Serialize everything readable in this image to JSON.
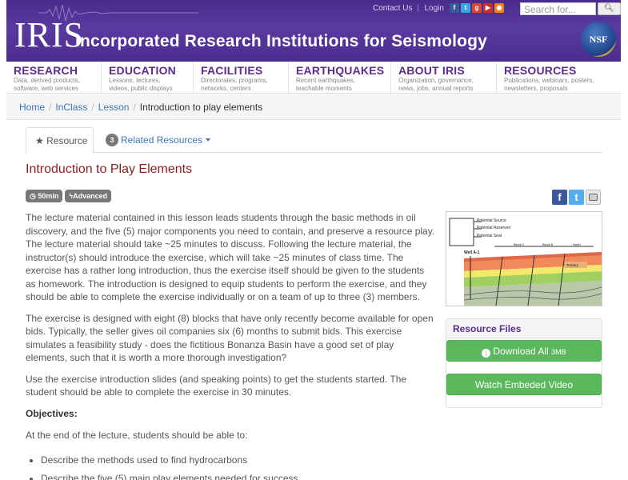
{
  "header": {
    "logo_text": "IRIS",
    "org_title": "Incorporated Research Institutions for Seismology",
    "top_links": [
      "Contact Us",
      "Login"
    ],
    "social_icons": [
      "facebook-icon",
      "twitter-icon",
      "google-plus-icon",
      "youtube-icon",
      "rss-icon"
    ],
    "search_placeholder": "Search for...",
    "nsf_logo_text": "NSF"
  },
  "nav": [
    {
      "title": "RESEARCH",
      "sub1": "Data, derived products,",
      "sub2": "software, web services"
    },
    {
      "title": "EDUCATION",
      "sub1": "Lessons, lectures,",
      "sub2": "videos, public displays"
    },
    {
      "title": "FACILITIES",
      "sub1": "Directorates, programs,",
      "sub2": "networks, centers"
    },
    {
      "title": "EARTHQUAKES",
      "sub1": "Recent earthquakes,",
      "sub2": "teachable moments"
    },
    {
      "title": "ABOUT IRIS",
      "sub1": "Organization, governance,",
      "sub2": "news, jobs, annual reports"
    },
    {
      "title": "RESOURCES",
      "sub1": "Publications, webinars, posters,",
      "sub2": "newsletters, proposals"
    }
  ],
  "breadcrumb": [
    "Home",
    "InClass",
    "Lesson",
    "Introduction to play elements"
  ],
  "tabs": {
    "resource": "Resource",
    "related_count": "3",
    "related": "Related Resources"
  },
  "lesson": {
    "title": "Introduction to Play Elements",
    "duration": "50min",
    "level": "Advanced",
    "paragraphs": [
      "The lecture material contained in this lesson leads students through the basic methods in oil discovery, and the five (5) major components you need to contain, and preserve a resource play. The lecture material should take ~25 minutes to discuss. Following the lecture material, the instructor(s) should introduce the exercise, which will take ~25 minutes of class time. The exercise has a rather long introduction, thus the exercise itself should be given to the students as homework. The introduction is designed to equip students to perform the exercise, and they should be able to complete the exercise individually or on a team of up to three (3) members.",
      "The exercise is designed with eight (8) blocks that have only recently become available for open bids. Typically, the seller gives oil companies six (6) months to submit bids. This exercise simulates a feasibility study - does the fictitious Bonanza Basin have a good set of play elements, such that it is worth a more thorough investigation?",
      "Use the exercise introduction slides (and speaking points) to get the students started. The student should be able to complete the exercise in 30 minutes."
    ],
    "objectives_heading": "Objectives:",
    "objectives_intro": "At the end of the lecture, students should be able to:",
    "objectives": [
      "Describe the methods used to find hydrocarbons",
      "Describe the five (5) main play elements needed for success"
    ]
  },
  "sidebar": {
    "thumb_labels": {
      "source": "Potential Source",
      "reservoir": "Potential Reservoir",
      "seal": "Potential Seal",
      "block2": "Block 2",
      "block6": "Block 6",
      "north": "North",
      "well": "Well A-1",
      "tertiary": "Tertiary"
    },
    "resource_files_heading": "Resource Files",
    "download_label": "Download All",
    "download_size": "3MB",
    "video_label": "Watch Embeded Video"
  }
}
